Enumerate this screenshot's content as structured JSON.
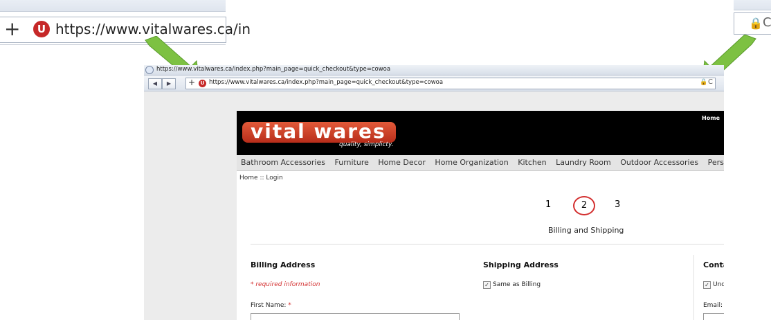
{
  "zoom_left": {
    "url": "https://www.vitalwares.ca/in",
    "plus": "+",
    "shield_letter": "U"
  },
  "zoom_right": {
    "lock": "🔒",
    "reload": "C"
  },
  "browser": {
    "title": "https://www.vitalwares.ca/index.php?main_page=quick_checkout&type=cowoa",
    "url": "https://www.vitalwares.ca/index.php?main_page=quick_checkout&type=cowoa",
    "back": "◀",
    "forward": "▶",
    "plus": "+",
    "shield_letter": "U",
    "lock": "🔒",
    "reload": "C"
  },
  "site": {
    "logo": "vital wares",
    "tagline": "quality, simplicty.",
    "home_link": "Home",
    "menu": [
      "Bathroom Accessories",
      "Furniture",
      "Home Decor",
      "Home Organization",
      "Kitchen",
      "Laundry Room",
      "Outdoor Accessories",
      "Personal Accessor"
    ],
    "breadcrumb": "Home :: Login"
  },
  "checkout": {
    "steps": [
      "1",
      "2",
      "3"
    ],
    "active_step": 2,
    "step_label": "Billing and Shipping",
    "billing_heading": "Billing Address",
    "required_note": "* required information",
    "first_name_label": "First Name:",
    "required_star": "*",
    "shipping_heading": "Shipping Address",
    "same_as_billing": "Same as Billing",
    "contact_heading": "Conta",
    "contact_checkbox": "Unc",
    "email_label": "Email:"
  },
  "colors": {
    "arrow": "#7dc142",
    "logo_red": "#c9381f",
    "required_red": "#d32f2f"
  }
}
